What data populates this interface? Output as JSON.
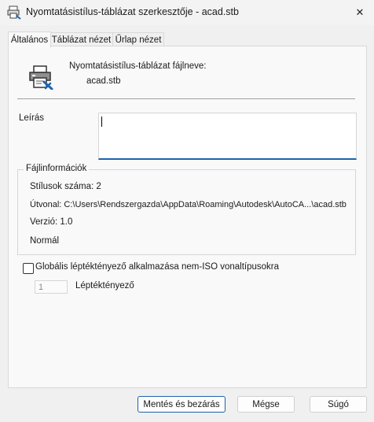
{
  "window": {
    "title": "Nyomtatásistílus-táblázat szerkesztője - acad.stb",
    "close_glyph": "✕"
  },
  "tabs": [
    {
      "label": "Általános",
      "active": true
    },
    {
      "label": "Táblázat nézet",
      "active": false
    },
    {
      "label": "Űrlap nézet",
      "active": false
    }
  ],
  "general": {
    "file_name_label": "Nyomtatásistílus-táblázat fájlneve:",
    "file_name_value": "acad.stb",
    "description_label": "Leírás",
    "description_value": "",
    "file_info": {
      "title": "Fájlinformációk",
      "styles_count": "Stílusok száma: 2",
      "path": "Útvonal: C:\\Users\\Rendszergazda\\AppData\\Roaming\\Autodesk\\AutoCA...\\acad.stb",
      "version": "Verzió: 1.0",
      "type": "Normál"
    },
    "scale_checkbox_label": "Globális léptéktényező alkalmazása nem-ISO vonaltípusokra",
    "scale_checkbox_checked": false,
    "scale_factor_value": "1",
    "scale_factor_label": "Léptéktényező"
  },
  "buttons": {
    "save_close": "Mentés és bezárás",
    "cancel": "Mégse",
    "help": "Súgó"
  },
  "colors": {
    "accent": "#1d62b0",
    "panel": "#f9f9f9",
    "window": "#f0f0f0"
  }
}
